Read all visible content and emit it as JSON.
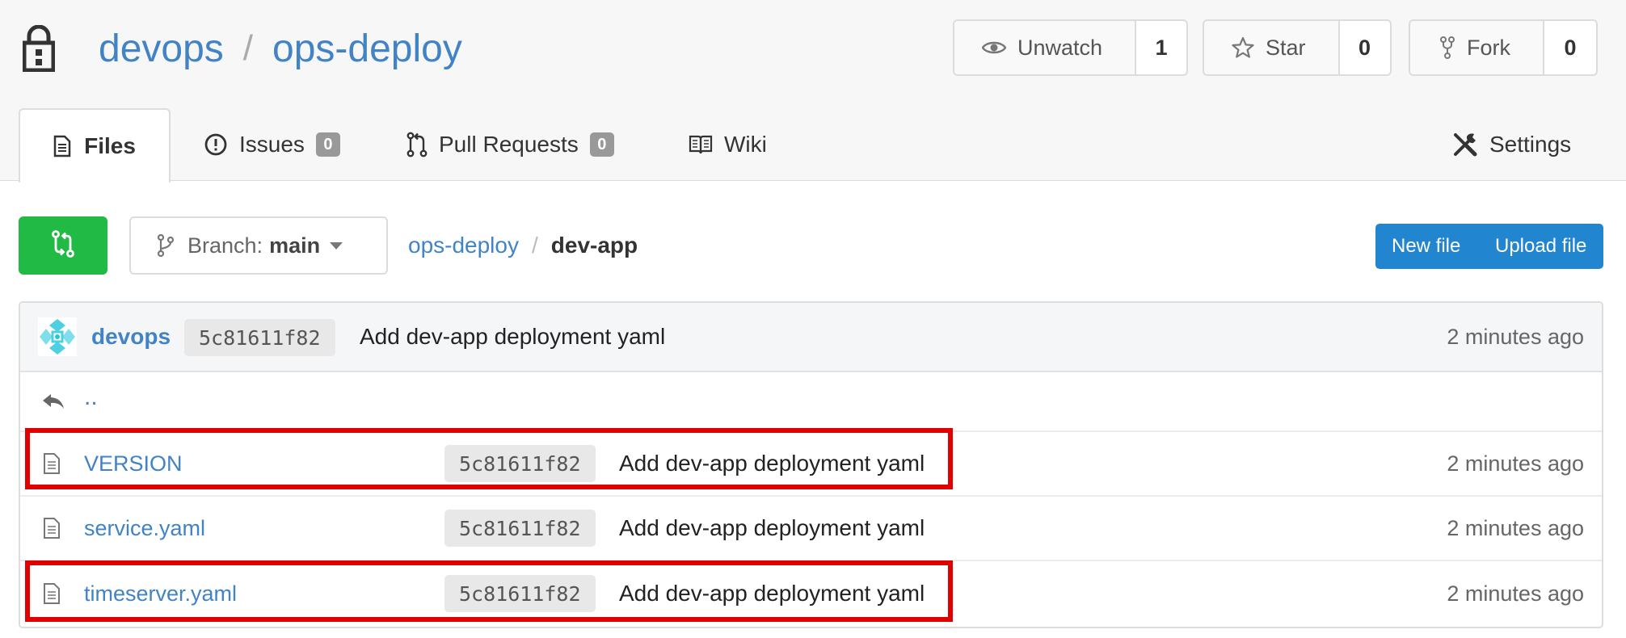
{
  "repo": {
    "owner": "devops",
    "separator": "/",
    "name": "ops-deploy"
  },
  "actions": {
    "unwatch": {
      "label": "Unwatch",
      "count": "1"
    },
    "star": {
      "label": "Star",
      "count": "0"
    },
    "fork": {
      "label": "Fork",
      "count": "0"
    }
  },
  "tabs": {
    "files": {
      "label": "Files"
    },
    "issues": {
      "label": "Issues",
      "count": "0"
    },
    "pull_requests": {
      "label": "Pull Requests",
      "count": "0"
    },
    "wiki": {
      "label": "Wiki"
    },
    "settings": {
      "label": "Settings"
    }
  },
  "toolbar": {
    "branch_prefix": "Branch:",
    "branch_name": "main",
    "new_file": "New file",
    "upload_file": "Upload file"
  },
  "breadcrumb": {
    "root": "ops-deploy",
    "separator": "/",
    "current": "dev-app"
  },
  "latest_commit": {
    "user": "devops",
    "sha": "5c81611f82",
    "message": "Add dev-app deployment yaml",
    "time": "2 minutes ago"
  },
  "parent_dir": "..",
  "files": [
    {
      "name": "VERSION",
      "sha": "5c81611f82",
      "message": "Add dev-app deployment yaml",
      "time": "2 minutes ago",
      "highlighted": true
    },
    {
      "name": "service.yaml",
      "sha": "5c81611f82",
      "message": "Add dev-app deployment yaml",
      "time": "2 minutes ago",
      "highlighted": false
    },
    {
      "name": "timeserver.yaml",
      "sha": "5c81611f82",
      "message": "Add dev-app deployment yaml",
      "time": "2 minutes ago",
      "highlighted": true
    }
  ],
  "colors": {
    "link": "#4183c4",
    "compare_button": "#21ba45",
    "primary_button": "#2185d0",
    "highlight_box": "#e00000",
    "badge": "#999999"
  },
  "icons": {
    "repo": "lock-icon",
    "unwatch": "eye-icon",
    "star": "star-icon",
    "fork": "fork-icon",
    "files_tab": "file-text-icon",
    "issues_tab": "issue-opened-icon",
    "pulls_tab": "pull-request-icon",
    "wiki_tab": "book-icon",
    "settings_tab": "tools-icon",
    "compare": "compare-icon",
    "branch": "branch-icon",
    "parent": "reply-arrow-icon",
    "file": "file-icon"
  }
}
